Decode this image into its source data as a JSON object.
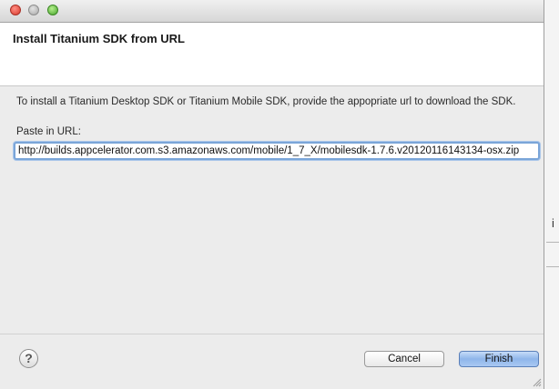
{
  "dialog": {
    "header_title": "Install Titanium SDK from URL",
    "description": "To install a Titanium Desktop SDK or Titanium Mobile SDK, provide the appopriate url to download the SDK.",
    "url_label": "Paste in URL:",
    "url_value": "http://builds.appcelerator.com.s3.amazonaws.com/mobile/1_7_X/mobilesdk-1.7.6.v20120116143134-osx.zip",
    "help_glyph": "?",
    "cancel_label": "Cancel",
    "finish_label": "Finish"
  },
  "background": {
    "edge_char": "i"
  },
  "colors": {
    "focus_ring": "#7aa5d8",
    "default_button": "#8fb6ea",
    "header_bg": "#ffffff",
    "dialog_bg": "#ececec"
  },
  "icons": {
    "help": "help-icon",
    "close": "close-icon",
    "minimize": "minimize-icon",
    "maximize": "maximize-icon",
    "resize": "resize-grip-icon"
  }
}
